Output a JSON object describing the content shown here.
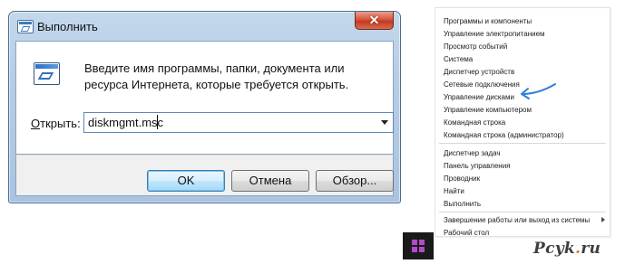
{
  "run_dialog": {
    "title": "Выполнить",
    "close_glyph": "✕",
    "description": "Введите имя программы, папки, документа или ресурса Интернета, которые требуется открыть.",
    "open_label_accel": "О",
    "open_label_rest": "ткрыть:",
    "open_value": "diskmgmt.msc",
    "buttons": {
      "ok": "OK",
      "cancel": "Отмена",
      "browse": "Обзор..."
    }
  },
  "context_menu": {
    "items": [
      "Программы и компоненты",
      "Управление электропитанием",
      "Просмотр событий",
      "Система",
      "Диспетчер устройств",
      "Сетевые подключения",
      "Управление дисками",
      "Управление компьютером",
      "Командная строка",
      "Командная строка (администратор)",
      "Диспетчер задач",
      "Панель управления",
      "Проводник",
      "Найти",
      "Выполнить",
      "Завершение работы или выход из системы",
      "Рабочий стол"
    ],
    "highlighted_item": "Управление дисками",
    "annotation_color": "#2f7fd6"
  },
  "start_button": {
    "logo_color": "#b34ac9",
    "icon": "windows-logo-icon"
  },
  "watermark": {
    "main": "Pcyk",
    "dot": ".",
    "tld": "ru"
  }
}
